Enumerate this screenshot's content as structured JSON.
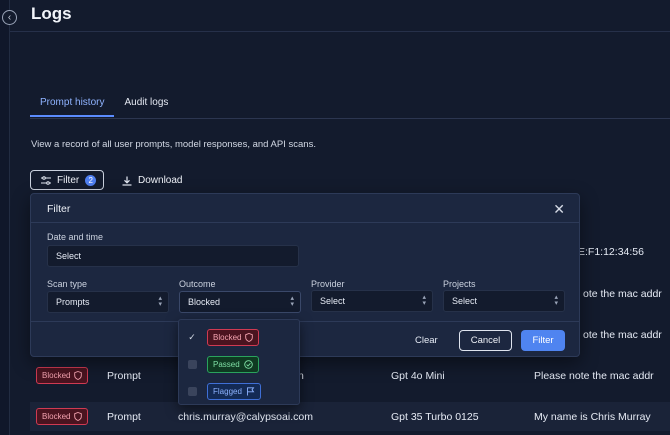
{
  "page": {
    "title": "Logs"
  },
  "tabs": [
    {
      "label": "Prompt history",
      "active": true
    },
    {
      "label": "Audit logs",
      "active": false
    }
  ],
  "description": "View a record of all user prompts, model responses, and API scans.",
  "toolbar": {
    "filter_label": "Filter",
    "filter_count": "2",
    "download_label": "Download"
  },
  "background_rows": [
    {
      "peek": "E:F1:12:34:56"
    },
    {
      "peek": "ote the mac addr"
    },
    {
      "peek": "ote the mac addr"
    },
    {
      "badge": "Blocked",
      "type": "Prompt",
      "user": "n",
      "model": "Gpt 4o Mini",
      "text": "Please note the mac addr"
    },
    {
      "badge": "Blocked",
      "type": "Prompt",
      "user": "chris.murray@calypsoai.com",
      "model": "Gpt 35 Turbo 0125",
      "text": "My name is Chris Murray"
    }
  ],
  "modal": {
    "title": "Filter",
    "date_label": "Date and time",
    "date_value": "Select",
    "scan_type_label": "Scan type",
    "scan_type_value": "Prompts",
    "outcome_label": "Outcome",
    "outcome_value": "Blocked",
    "provider_label": "Provider",
    "provider_value": "Select",
    "projects_label": "Projects",
    "projects_value": "Select",
    "clear_label": "Clear",
    "cancel_label": "Cancel",
    "filter_label": "Filter"
  },
  "outcome_options": [
    {
      "label": "Blocked",
      "checked": true,
      "style": "blocked",
      "icon": "shield-icon"
    },
    {
      "label": "Passed",
      "checked": false,
      "style": "passed",
      "icon": "check-circle-icon"
    },
    {
      "label": "Flagged",
      "checked": false,
      "style": "flagged",
      "icon": "flag-icon"
    }
  ],
  "colors": {
    "accent": "#4f84f0",
    "background": "#131b2d",
    "modal": "#1c2740"
  }
}
